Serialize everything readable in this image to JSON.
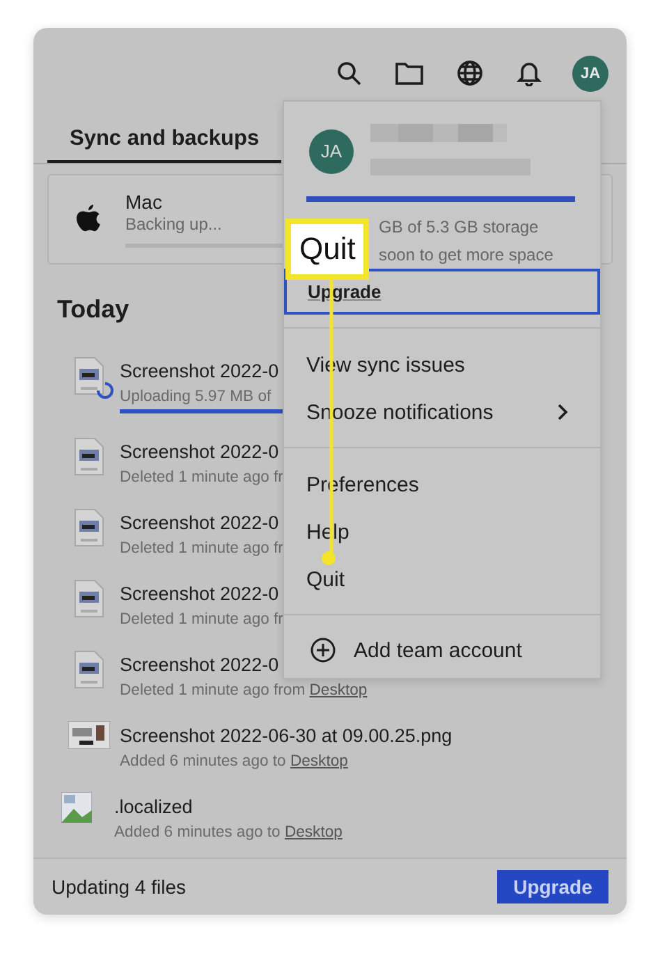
{
  "toolbar": {
    "avatar": "JA"
  },
  "tabs": [
    {
      "label": "Sync and backups",
      "selected": true
    }
  ],
  "device": {
    "name": "Mac",
    "status": "Backing up..."
  },
  "section": "Today",
  "files": [
    {
      "kind": "uploading",
      "name": "Screenshot 2022-0",
      "detail": "Uploading 5.97 MB of"
    },
    {
      "kind": "deleted",
      "name": "Screenshot 2022-0",
      "detail": "Deleted 1 minute ago fr"
    },
    {
      "kind": "deleted",
      "name": "Screenshot 2022-0",
      "detail": "Deleted 1 minute ago fr"
    },
    {
      "kind": "deleted",
      "name": "Screenshot 2022-0",
      "detail": "Deleted 1 minute ago fr"
    },
    {
      "kind": "deleted",
      "name": "Screenshot 2022-0",
      "detail": "Deleted 1 minute ago from",
      "link": "Desktop"
    },
    {
      "kind": "added",
      "name": "Screenshot 2022-06-30 at 09.00.25.png",
      "detail": "Added 6 minutes ago to",
      "link": "Desktop"
    },
    {
      "kind": "added",
      "name": ".localized",
      "detail": "Added 6 minutes ago to",
      "link": "Desktop"
    }
  ],
  "menu": {
    "avatar": "JA",
    "storage": {
      "level": 1,
      "lines": [
        "GB of 5.3 GB storage",
        "soon to get more space"
      ]
    },
    "upgrade": {
      "label": "Upgrade",
      "focused": true
    },
    "groups": [
      [
        {
          "label": "View sync issues",
          "submenu": false
        },
        {
          "label": "Snooze notifications",
          "submenu": true
        }
      ],
      [
        {
          "label": "Preferences",
          "submenu": false
        },
        {
          "label": "Help",
          "submenu": false
        },
        {
          "label": "Quit",
          "submenu": false
        }
      ]
    ],
    "add_account": "Add team account"
  },
  "callout": {
    "label": "Quit"
  },
  "footer": {
    "status": "Updating 4 files",
    "button": "Upgrade"
  }
}
